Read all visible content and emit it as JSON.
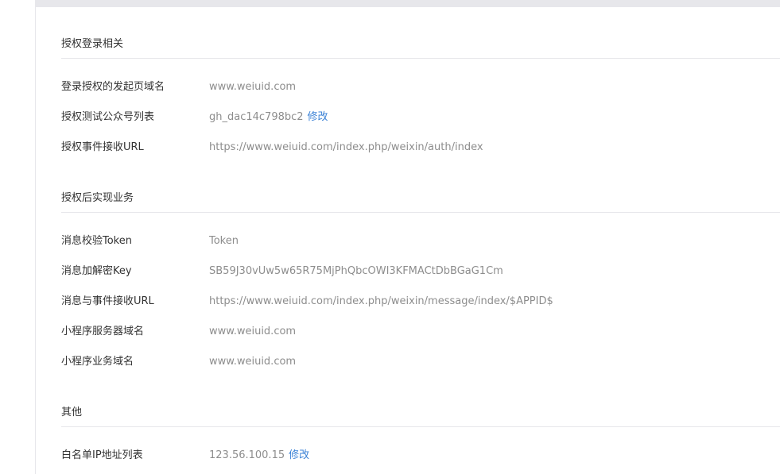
{
  "sections": [
    {
      "title": "授权登录相关",
      "rows": [
        {
          "label": "登录授权的发起页域名",
          "value": "www.weiuid.com"
        },
        {
          "label": "授权测试公众号列表",
          "value": "gh_dac14c798bc2",
          "action": "修改"
        },
        {
          "label": "授权事件接收URL",
          "value": "https://www.weiuid.com/index.php/weixin/auth/index"
        }
      ]
    },
    {
      "title": "授权后实现业务",
      "rows": [
        {
          "label": "消息校验Token",
          "value": "Token"
        },
        {
          "label": "消息加解密Key",
          "value": "SB59J30vUw5w65R75MjPhQbcOWI3KFMACtDbBGaG1Cm"
        },
        {
          "label": "消息与事件接收URL",
          "value": "https://www.weiuid.com/index.php/weixin/message/index/$APPID$"
        },
        {
          "label": "小程序服务器域名",
          "value": "www.weiuid.com"
        },
        {
          "label": "小程序业务域名",
          "value": "www.weiuid.com"
        }
      ]
    },
    {
      "title": "其他",
      "rows": [
        {
          "label": "白名单IP地址列表",
          "value": "123.56.100.15",
          "action": "修改"
        }
      ]
    }
  ]
}
